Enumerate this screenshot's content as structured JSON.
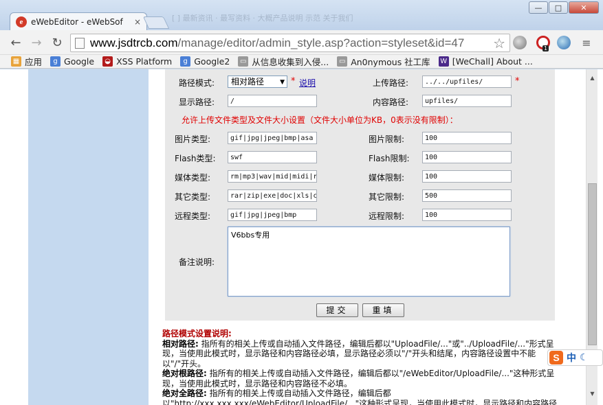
{
  "browser": {
    "tab_title": "eWebEditor - eWebSof",
    "tab_favicon": "e",
    "tab_close": "×",
    "bg_title": "[ ] 最新资讯 · 最写资料 · 大概产品说明   示范    关于我们",
    "url_scheme_host": "www.jsdtrcb.com",
    "url_path": "/manage/editor/admin_style.asp?action=styleset&id=47",
    "window_buttons": [
      "—",
      "□",
      "✕"
    ],
    "ime_label": "中",
    "ime_logo": "S",
    "extension_badge": "1"
  },
  "bookmarks": [
    {
      "label": "应用",
      "icon": "apps-grid-icon",
      "glyph": "▦",
      "color": "#e8a33a"
    },
    {
      "label": "Google",
      "icon": "google-icon",
      "glyph": "g",
      "color": "#4a7fd6"
    },
    {
      "label": "XSS Platform",
      "icon": "xss-platform-icon",
      "glyph": "◒",
      "color": "#b31b1b"
    },
    {
      "label": "Google2",
      "icon": "google-icon",
      "glyph": "g",
      "color": "#4a7fd6"
    },
    {
      "label": "从信息收集到入侵...",
      "icon": "page-icon",
      "glyph": "▭",
      "color": "#999999"
    },
    {
      "label": "An0nymous 社工库",
      "icon": "page-icon",
      "glyph": "▭",
      "color": "#999999"
    },
    {
      "label": "[WeChall] About ...",
      "icon": "wechall-icon",
      "glyph": "W",
      "color": "#4b2a8a"
    }
  ],
  "form": {
    "path_mode_label": "路径模式:",
    "path_mode_value": "相对路径",
    "explain_link": "说明",
    "required_mark": "*",
    "upload_path_label": "上传路径:",
    "upload_path_value": "../../upfiles/",
    "display_path_label": "显示路径:",
    "display_path_value": "/",
    "content_path_label": "内容路径:",
    "content_path_value": "upfiles/",
    "notice": "允许上传文件类型及文件大小设置（文件大小单位为KB，0表示没有限制）：",
    "rows": [
      {
        "type_label": "图片类型:",
        "type_value": "gif|jpg|jpeg|bmp|asa",
        "limit_label": "图片限制:",
        "limit_value": "100"
      },
      {
        "type_label": "Flash类型:",
        "type_value": "swf",
        "limit_label": "Flash限制:",
        "limit_value": "100"
      },
      {
        "type_label": "媒体类型:",
        "type_value": "rm|mp3|wav|mid|midi|r",
        "limit_label": "媒体限制:",
        "limit_value": "100"
      },
      {
        "type_label": "其它类型:",
        "type_value": "rar|zip|exe|doc|xls|c",
        "limit_label": "其它限制:",
        "limit_value": "500"
      },
      {
        "type_label": "远程类型:",
        "type_value": "gif|jpg|jpeg|bmp",
        "limit_label": "远程限制:",
        "limit_value": "100"
      }
    ],
    "remark_label": "备注说明:",
    "remark_value": "V6bbs专用",
    "submit_label": "提交",
    "reset_label": "重填"
  },
  "help": {
    "heading": "路径模式设置说明:",
    "relative_term": "相对路径:",
    "relative_text": " 指所有的相关上传或自动插入文件路径，编辑后都以\"UploadFile/...\"或\"../UploadFile/...\"形式呈现，当使用此模式时，显示路径和内容路径必填，显示路径必须以\"/\"开头和结尾，内容路径设置中不能以\"/\"开头。",
    "absolute_root_term": "绝对根路径:",
    "absolute_root_text": " 指所有的相关上传或自动插入文件路径，编辑后都以\"/eWebEditor/UploadFile/...\"这种形式呈现，当使用此模式时，显示路径和内容路径不必填。",
    "absolute_full_term": "绝对全路径:",
    "absolute_full_text": " 指所有的相关上传或自动插入文件路径，编辑后都以\"http://xxx.xxx.xxx/eWebEditor/UploadFile/...\"这种形式呈现，当使用此模式时，显示路径和内容路径"
  }
}
